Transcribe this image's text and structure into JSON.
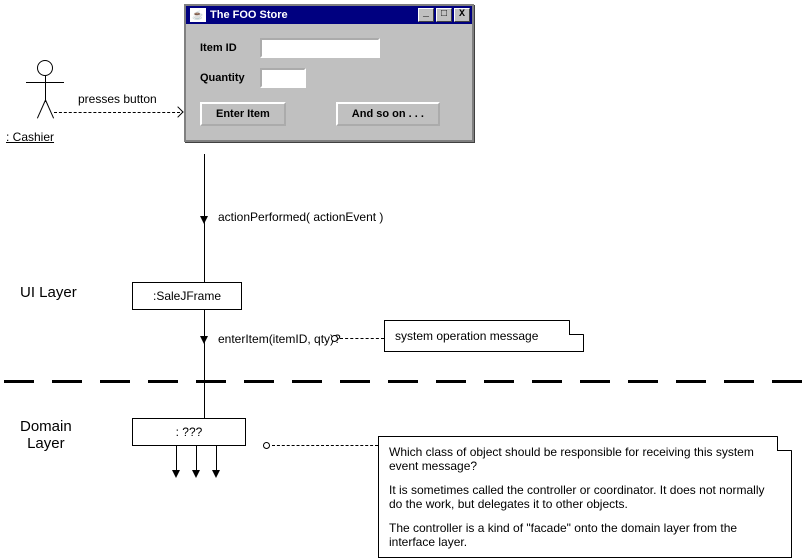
{
  "actor": {
    "label": ": Cashier"
  },
  "presses": "presses button",
  "window": {
    "title": "The FOO Store",
    "field1_label": "Item ID",
    "field2_label": "Quantity",
    "btn_enter": "Enter Item",
    "btn_more": "And so on . . ."
  },
  "msg_action": "actionPerformed( actionEvent )",
  "ui_layer_label": "UI Layer",
  "ui_box": ":SaleJFrame",
  "msg_enter": "enterItem(itemID, qty)?",
  "note_sys_op": "system operation message",
  "domain_layer_label": "Domain\nLayer",
  "domain_box": ": ???",
  "note_domain_p1": "Which class of object should be responsible for receiving this system event message?",
  "note_domain_p2": "It is sometimes called the controller or coordinator. It does not normally do the work, but delegates it to other objects.",
  "note_domain_p3": "The controller is a kind of \"facade\" onto the domain layer from the interface layer."
}
